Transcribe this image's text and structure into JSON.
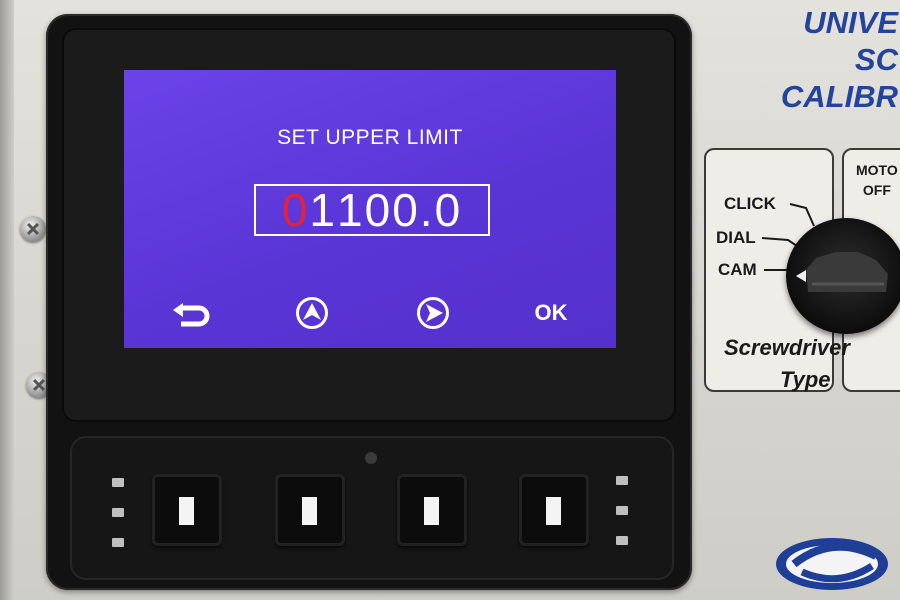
{
  "lcd": {
    "title": "SET UPPER LIMIT",
    "value_digits": [
      {
        "char": "0",
        "active": true
      },
      {
        "char": "1",
        "active": false
      },
      {
        "char": "1",
        "active": false
      },
      {
        "char": "0",
        "active": false
      },
      {
        "char": "0",
        "active": false
      },
      {
        "char": ".0",
        "active": false
      }
    ],
    "softkeys": {
      "back_icon": "return-arrow-icon",
      "up_icon": "circled-up-arrow-icon",
      "right_icon": "circled-right-arrow-icon",
      "ok_label": "OK"
    },
    "background_color": "#5a35d6",
    "active_digit_color": "#e0223a"
  },
  "brand": {
    "line1": "UNIVE",
    "line2": "SC",
    "line3": "CALIBR",
    "color": "#23449a"
  },
  "selector": {
    "options": [
      "CLICK",
      "DIAL",
      "CAM"
    ],
    "selected": "CAM",
    "caption_line1": "Screwdriver",
    "caption_line2": "Type"
  },
  "motor": {
    "line1": "MOTO",
    "line2": "OFF"
  }
}
